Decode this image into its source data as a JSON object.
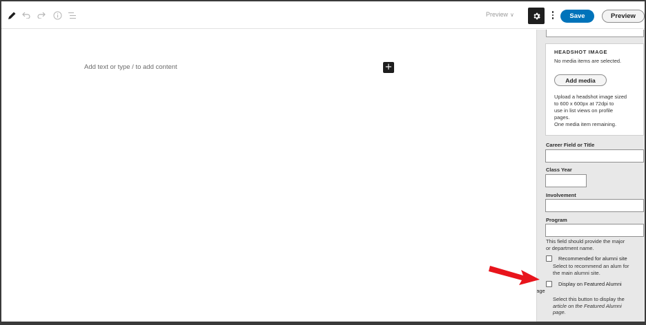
{
  "toolbar": {
    "icons": [
      "pencil-icon",
      "undo-icon",
      "redo-icon",
      "info-icon",
      "list-view-icon"
    ],
    "preview_dropdown": "Preview",
    "save_label": "Save",
    "preview_label": "Preview"
  },
  "editor": {
    "placeholder": "Add text or type / to add content"
  },
  "sidebar": {
    "headshot": {
      "title": "HEADSHOT IMAGE",
      "note": "No media items are selected.",
      "add_media_label": "Add media",
      "description_lines": [
        "Upload a headshot image sized",
        "to 600 x 600px at 72dpi to",
        "use in list views on profile",
        "pages.",
        "One media item remaining."
      ]
    },
    "fields": {
      "career": {
        "label": "Career Field or Title",
        "value": ""
      },
      "class_year": {
        "label": "Class Year",
        "value": ""
      },
      "involvement": {
        "label": "Involvement",
        "value": ""
      },
      "program": {
        "label": "Program",
        "value": "",
        "help_lines": [
          "This field should provide the major",
          "or department name."
        ]
      }
    },
    "checkboxes": {
      "recommended": {
        "label": "Recommended for alumni site",
        "checked": false,
        "help_lines": [
          "Select to recommend an alum for",
          "the main alumni site."
        ]
      },
      "featured": {
        "label_line1": "Display on Featured Alumni",
        "label_line2": "page",
        "checked": false,
        "help_line1": "Select this button to display the",
        "help_line2": "article on the Featured Alumni",
        "help_line3": "page."
      }
    }
  },
  "annotation": {
    "arrow_color": "#e8141c"
  }
}
